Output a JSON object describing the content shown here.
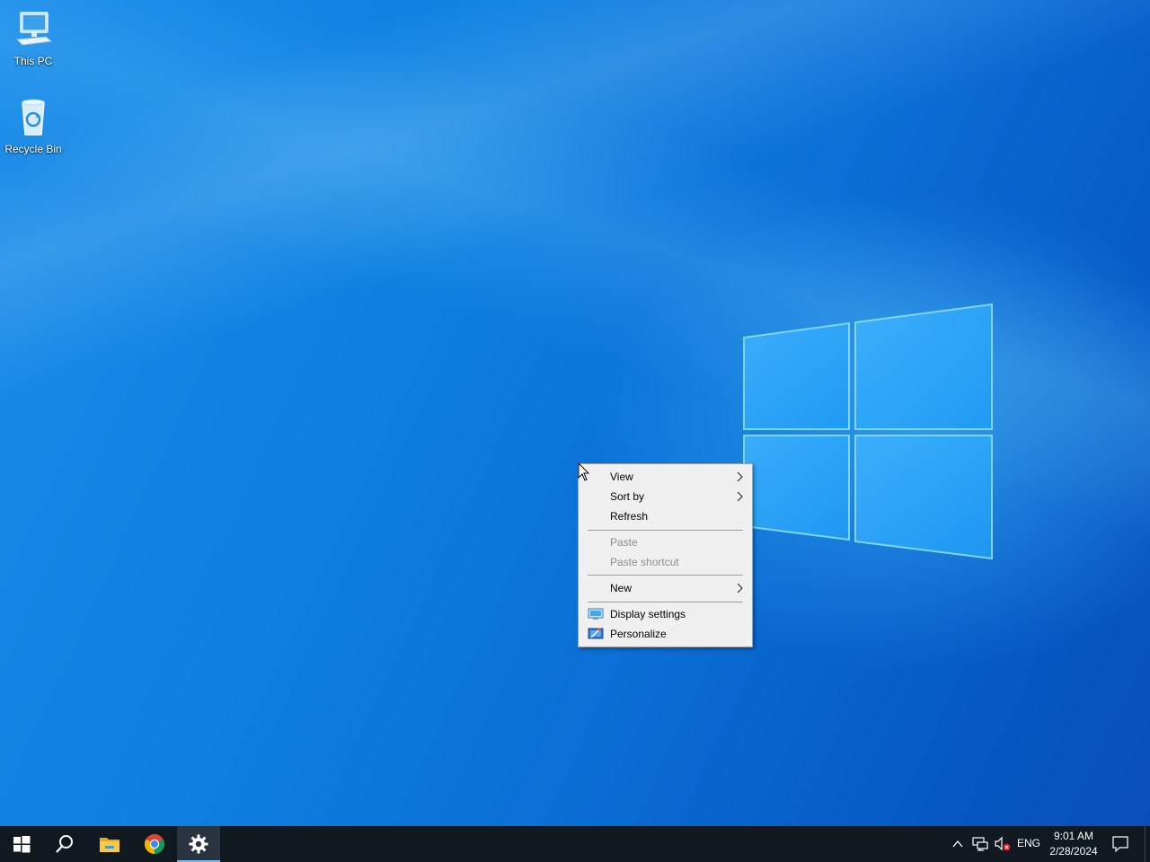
{
  "desktop": {
    "icons": [
      {
        "label": "This PC",
        "icon": "this-pc-icon"
      },
      {
        "label": "Recycle Bin",
        "icon": "recycle-bin-icon"
      }
    ]
  },
  "context_menu": {
    "items": [
      {
        "label": "View",
        "submenu": true,
        "enabled": true
      },
      {
        "label": "Sort by",
        "submenu": true,
        "enabled": true
      },
      {
        "label": "Refresh",
        "submenu": false,
        "enabled": true
      },
      {
        "label": "Paste",
        "submenu": false,
        "enabled": false
      },
      {
        "label": "Paste shortcut",
        "submenu": false,
        "enabled": false
      },
      {
        "label": "New",
        "submenu": true,
        "enabled": true
      },
      {
        "label": "Display settings",
        "submenu": false,
        "enabled": true,
        "icon": "display-settings-icon"
      },
      {
        "label": "Personalize",
        "submenu": false,
        "enabled": true,
        "icon": "personalize-icon"
      }
    ]
  },
  "taskbar": {
    "pinned": [
      {
        "name": "start",
        "icon": "windows-start-icon"
      },
      {
        "name": "search",
        "icon": "search-icon"
      },
      {
        "name": "file-explorer",
        "icon": "folder-icon"
      },
      {
        "name": "chrome",
        "icon": "chrome-icon"
      },
      {
        "name": "settings",
        "icon": "gear-icon",
        "active": true
      }
    ],
    "tray": {
      "language": "ENG",
      "time": "9:01 AM",
      "date": "2/28/2024"
    }
  },
  "colors": {
    "accent": "#0a78d8",
    "taskbar": "#101820",
    "menu_bg": "#f0f0f0",
    "disabled_text": "#8d8d8d"
  }
}
